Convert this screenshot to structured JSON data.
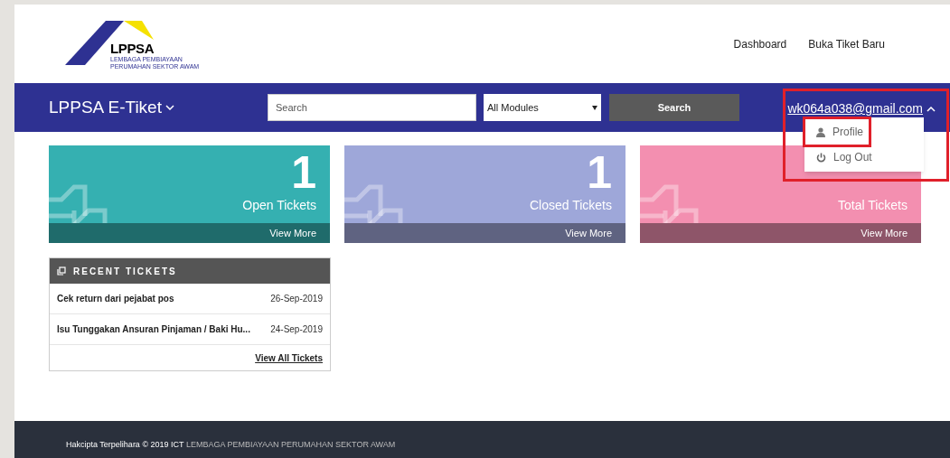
{
  "logo": {
    "wordmark": "LPPSA",
    "subtitle_1": "LEMBAGA PEMBIAYAAN",
    "subtitle_2": "PERUMAHAN SEKTOR AWAM"
  },
  "top_links": [
    "Dashboard",
    "Buka Tiket Baru"
  ],
  "navbar": {
    "brand": "LPPSA E-Tiket",
    "search": {
      "placeholder": "Search"
    },
    "module_select": "All Modules",
    "search_button": "Search",
    "user": "wk064a038@gmail.com",
    "menu_expanded": true
  },
  "user_menu": [
    {
      "kind": "profile",
      "label": "Profile",
      "highlighted": true
    },
    {
      "kind": "logout",
      "label": "Log Out",
      "highlighted": false
    }
  ],
  "cards": [
    {
      "count": "1",
      "label": "Open Tickets",
      "link": "View More",
      "color": "#35b0b1"
    },
    {
      "count": "1",
      "label": "Closed Tickets",
      "link": "View More",
      "color": "#9ea7d9"
    },
    {
      "label": "Total Tickets",
      "link": "View More",
      "color": "#f38fb0"
    }
  ],
  "recent_tickets": {
    "title": "RECENT TICKETS",
    "rows": [
      {
        "subject": "Cek return dari pejabat pos",
        "date": "26-Sep-2019"
      },
      {
        "subject": "Isu Tunggakan Ansuran Pinjaman / Baki Hu...",
        "date": "24-Sep-2019"
      }
    ],
    "link": "View All Tickets"
  },
  "footer": {
    "copyright": "Hakcipta Terpelihara © 2019 ICT",
    "organisation": "LEMBAGA PEMBIAYAAN PERUMAHAN SEKTOR AWAM"
  }
}
